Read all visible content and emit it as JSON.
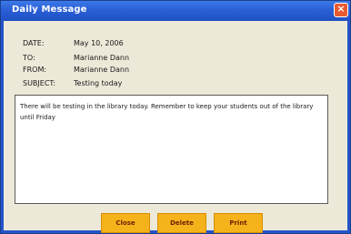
{
  "window": {
    "title": "Daily Message"
  },
  "message": {
    "date_label": "DATE:",
    "date_value": "May 10, 2006",
    "to_label": "TO:",
    "to_value": "Marianne Dann",
    "from_label": "FROM:",
    "from_value": "Marianne Dann",
    "subject_label": "SUBJECT:",
    "subject_value": "Testing today",
    "body": "There will be testing in the library today. Remember to keep your students out of the library until Friday"
  },
  "buttons": {
    "close": "Close",
    "delete": "Delete",
    "print": "Print"
  },
  "colors": {
    "title_bar": "#2a5fd6",
    "window_bg": "#ece9d8",
    "button_bg": "#f6b21b",
    "button_text": "#6b1f00",
    "close_button": "#e85a2f"
  },
  "icons": {
    "close": "close-icon"
  }
}
